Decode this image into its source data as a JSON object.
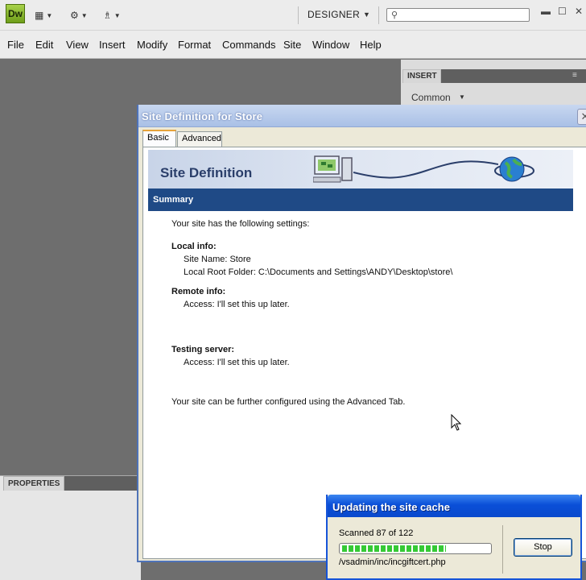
{
  "app": {
    "logo": "Dw",
    "workspace": "DESIGNER"
  },
  "menu": [
    "File",
    "Edit",
    "View",
    "Insert",
    "Modify",
    "Format",
    "Commands",
    "Site",
    "Window",
    "Help"
  ],
  "panels": {
    "insert_tab": "INSERT",
    "insert_category": "Common",
    "properties_tab": "PROPERTIES"
  },
  "dialog": {
    "title": "Site Definition for Store",
    "tabs": [
      "Basic",
      "Advanced"
    ],
    "banner_title": "Site Definition",
    "section": "Summary",
    "intro": "Your site has the following settings:",
    "local_heading": "Local info:",
    "site_name": "Site Name: Store",
    "local_root": "Local Root Folder: C:\\Documents and Settings\\ANDY\\Desktop\\store\\",
    "remote_heading": "Remote info:",
    "remote_access": "Access: I'll set this up later.",
    "testing_heading": "Testing server:",
    "testing_access": "Access: I'll set this up later.",
    "footer": "Your site can be further configured using the Advanced Tab."
  },
  "cache_popup": {
    "title": "Updating the site cache",
    "scanned": "Scanned 87 of 122",
    "progress_fraction": 0.71,
    "file": "/vsadmin/inc/incgiftcert.php",
    "stop_label": "Stop"
  },
  "icons": {
    "layout": "layout-icon",
    "gear": "gear-icon",
    "site": "site-icon",
    "search": "search-icon",
    "computer": "computer-icon",
    "globe": "globe-icon"
  },
  "colors": {
    "dialog_border": "#4f73b8",
    "summary_bar": "#1f4a86",
    "popup_title": "#0a4fd8",
    "progress": "#35c935"
  }
}
